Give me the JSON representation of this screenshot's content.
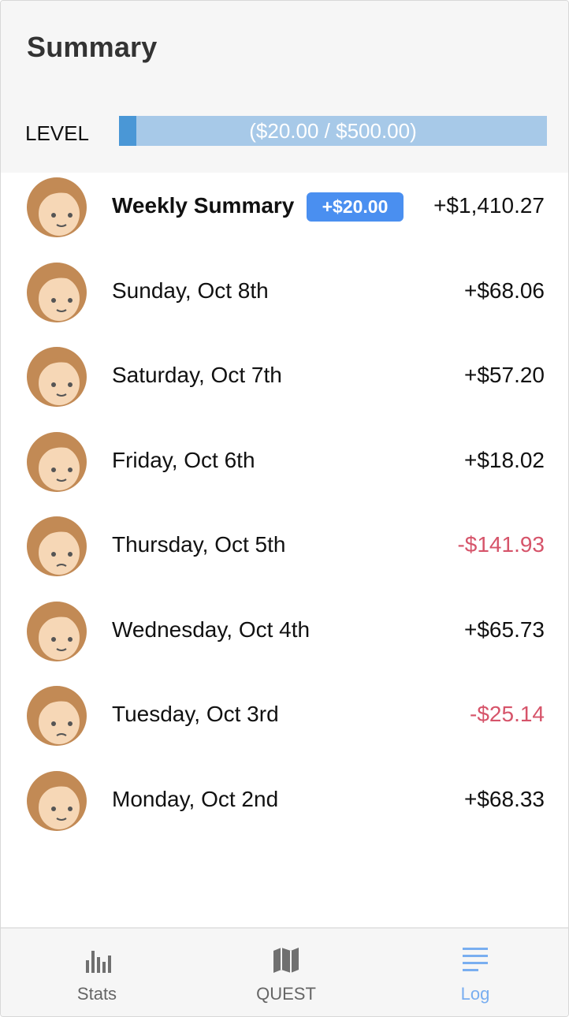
{
  "header": {
    "title": "Summary",
    "level_label": "LEVEL",
    "level_progress_text": "($20.00 / $500.00)",
    "level_progress": 0.04
  },
  "rows": [
    {
      "label": "Weekly Summary",
      "badge": "+$20.00",
      "amount": "+$1,410.27",
      "negative": false,
      "bold": true
    },
    {
      "label": "Sunday, Oct 8th",
      "amount": "+$68.06",
      "negative": false
    },
    {
      "label": "Saturday, Oct 7th",
      "amount": "+$57.20",
      "negative": false
    },
    {
      "label": "Friday, Oct 6th",
      "amount": "+$18.02",
      "negative": false
    },
    {
      "label": "Thursday, Oct 5th",
      "amount": "-$141.93",
      "negative": true
    },
    {
      "label": "Wednesday, Oct 4th",
      "amount": "+$65.73",
      "negative": false
    },
    {
      "label": "Tuesday, Oct 3rd",
      "amount": "-$25.14",
      "negative": true
    },
    {
      "label": "Monday, Oct 2nd",
      "amount": "+$68.33",
      "negative": false
    }
  ],
  "tabs": [
    {
      "label": "Stats",
      "icon": "bar-chart-icon",
      "active": false
    },
    {
      "label": "QUEST",
      "icon": "map-icon",
      "active": false
    },
    {
      "label": "Log",
      "icon": "list-icon",
      "active": true
    }
  ],
  "colors": {
    "accent": "#4a97d6",
    "badge": "#4a8ff0",
    "negative": "#d6546a",
    "active_tab": "#79aef0"
  }
}
